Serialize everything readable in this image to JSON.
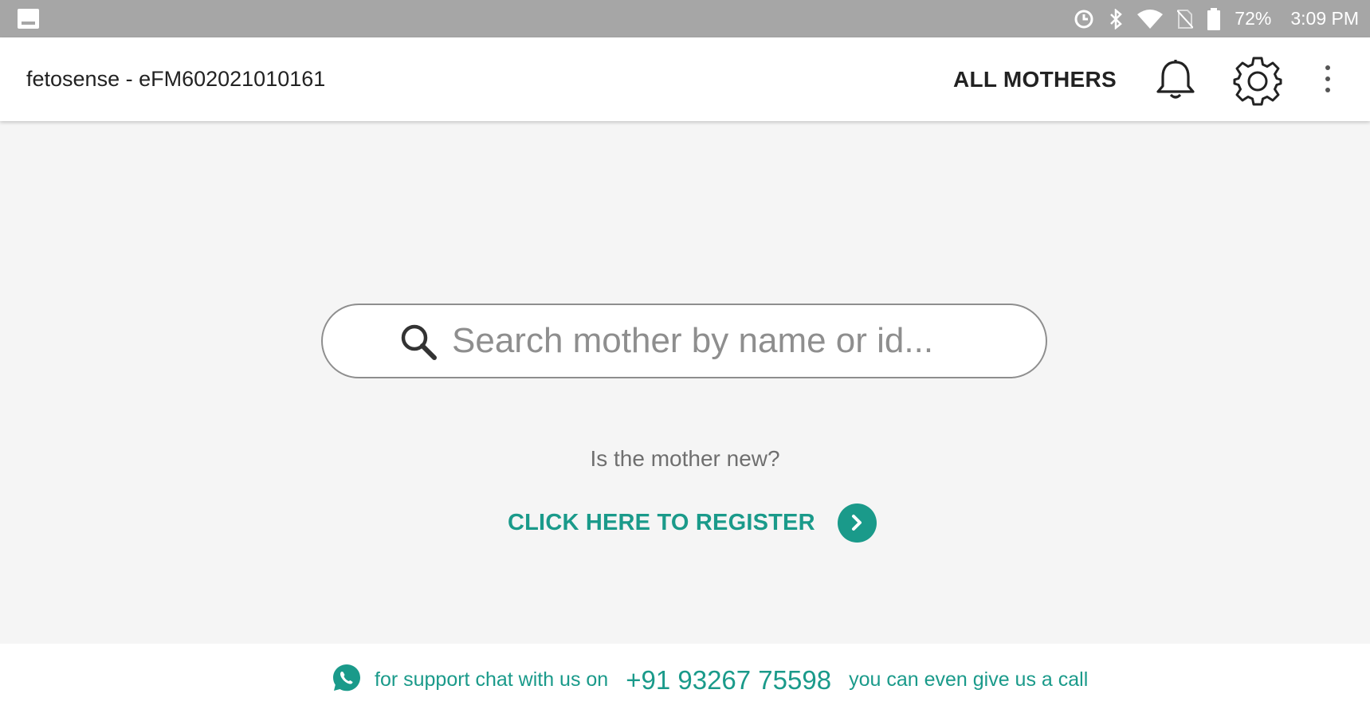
{
  "status_bar": {
    "battery": "72%",
    "time": "3:09 PM",
    "icons": [
      "image-icon",
      "sync-icon",
      "bluetooth-icon",
      "wifi-icon",
      "no-sim-icon",
      "battery-icon"
    ]
  },
  "app_bar": {
    "title": "fetosense - eFM602021010161",
    "all_mothers_label": "ALL MOTHERS",
    "icons": [
      "bell-icon",
      "gear-icon",
      "more-vert-icon"
    ]
  },
  "search": {
    "placeholder": "Search mother by name or id...",
    "value": ""
  },
  "register": {
    "question": "Is the mother new?",
    "link_label": "CLICK HERE TO REGISTER"
  },
  "footer": {
    "support_prefix": "for support chat with us on",
    "phone": "+91 93267 75598",
    "support_suffix": "you can even give us a call"
  },
  "colors": {
    "accent": "#1a9a8a",
    "status_bar": "#a6a6a6",
    "background": "#f5f5f5"
  }
}
